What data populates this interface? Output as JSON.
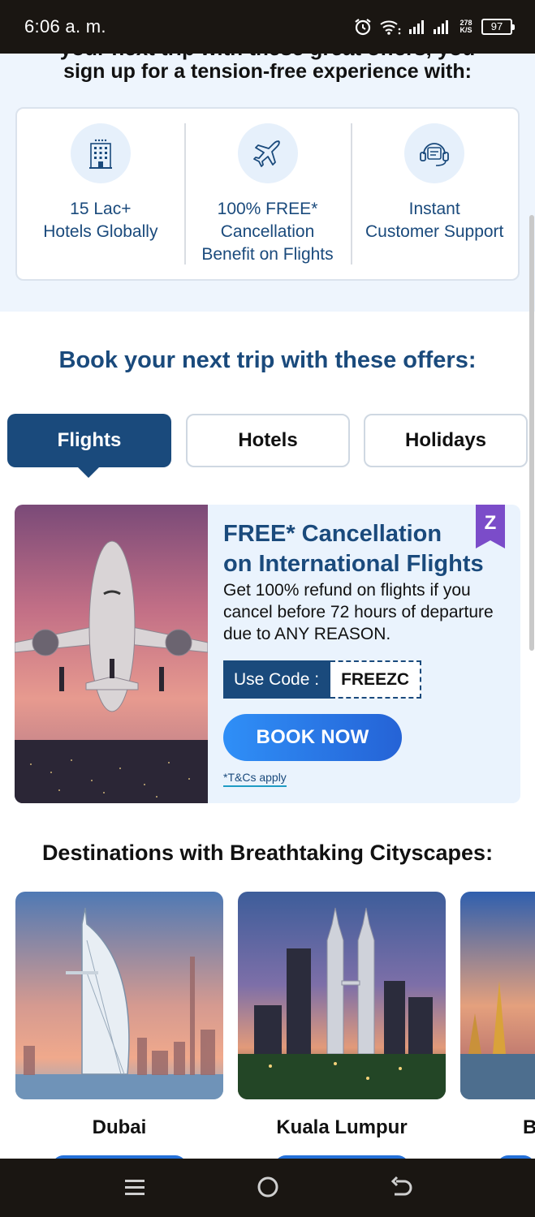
{
  "status_bar": {
    "time": "6:06 a. m.",
    "speed_value": "278",
    "speed_unit": "K/S",
    "battery": "97"
  },
  "benefits": {
    "cut_text": "your next trip with these great offers, you",
    "heading": "sign up for a tension-free experience with:",
    "items": [
      {
        "icon": "hotel-icon",
        "lines": [
          "15 Lac+",
          "Hotels Globally"
        ]
      },
      {
        "icon": "airplane-icon",
        "lines": [
          "100% FREE*",
          "Cancellation",
          "Benefit on Flights"
        ]
      },
      {
        "icon": "support-icon",
        "lines": [
          "Instant",
          "Customer Support"
        ]
      }
    ]
  },
  "offers": {
    "heading": "Book your next trip with these offers:",
    "tabs": [
      {
        "label": "Flights",
        "selected": true
      },
      {
        "label": "Hotels",
        "selected": false
      },
      {
        "label": "Holidays",
        "selected": false
      }
    ]
  },
  "offer_card": {
    "title_line1": "FREE* Cancellation",
    "title_line2": "on International Flights",
    "description": "Get 100% refund on flights if you cancel before 72 hours of departure due to ANY REASON.",
    "badge_letter": "Z",
    "code_label": "Use Code :",
    "code_value": "FREEZC",
    "cta": "BOOK NOW",
    "tnc": "*T&Cs apply"
  },
  "destinations": {
    "heading": "Destinations with Breathtaking Cityscapes:",
    "items": [
      {
        "name": "Dubai"
      },
      {
        "name": "Kuala Lumpur"
      },
      {
        "name": "B"
      }
    ]
  },
  "colors": {
    "brand_navy": "#1a4a7c",
    "cta_blue": "#2f8ff7",
    "light_bg": "#eef5fd",
    "badge_purple": "#7b4cc9"
  }
}
